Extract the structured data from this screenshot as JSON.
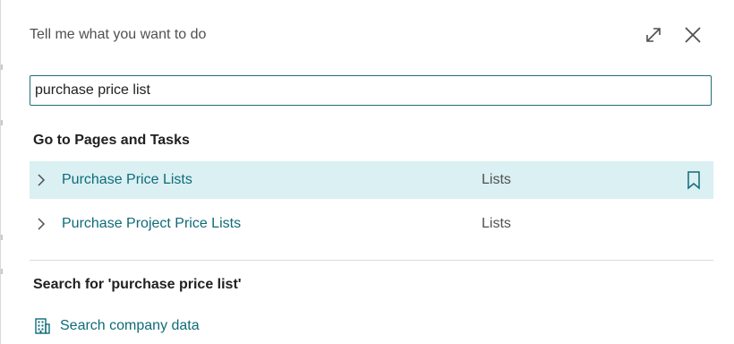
{
  "header": {
    "title": "Tell me what you want to do",
    "expand_icon": "expand-icon",
    "close_icon": "close-icon"
  },
  "search": {
    "value": "purchase price list",
    "placeholder": ""
  },
  "pages_section": {
    "title": "Go to Pages and Tasks",
    "results": [
      {
        "name": "Purchase Price Lists",
        "category": "Lists",
        "selected": true,
        "icon": "chevron-right-icon",
        "bookmark_icon": "bookmark-icon"
      },
      {
        "name": "Purchase Project Price Lists",
        "category": "Lists",
        "selected": false,
        "icon": "chevron-right-icon"
      }
    ]
  },
  "search_section": {
    "title": "Search for 'purchase price list'",
    "company_data_link": "Search company data",
    "company_icon": "building-icon"
  },
  "colors": {
    "accent": "#0f6b78",
    "selected_row": "#daf0f3",
    "input_border": "#1f6f78"
  }
}
